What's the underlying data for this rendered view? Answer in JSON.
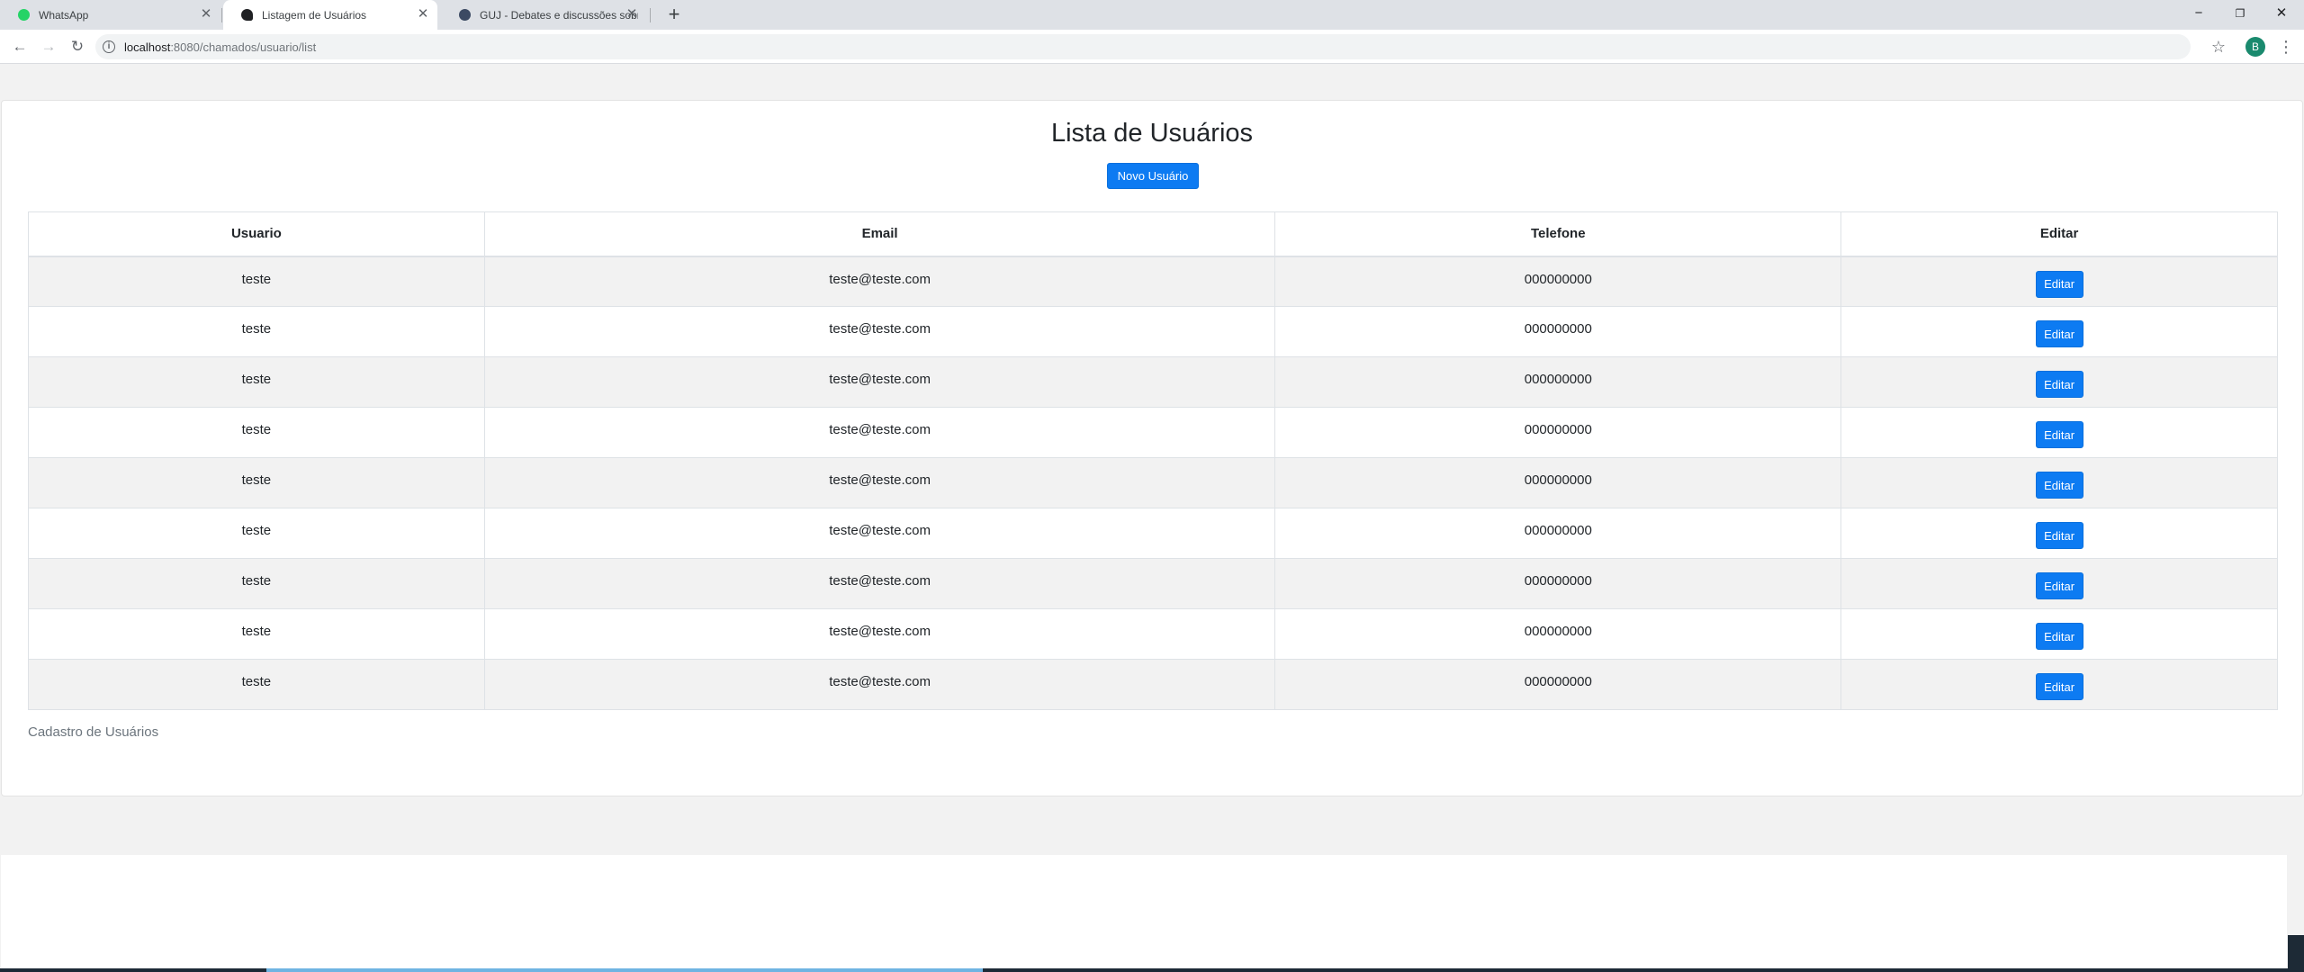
{
  "browser": {
    "tabs": [
      {
        "label": "WhatsApp",
        "favicon": "whatsapp-icon",
        "color": "#25d366",
        "active": false
      },
      {
        "label": "Listagem de Usuários",
        "favicon": "app-icon",
        "color": "#202124",
        "active": true
      },
      {
        "label": "GUJ - Debates e discussões sobre",
        "favicon": "guj-icon",
        "color": "#3c4a63",
        "active": false
      }
    ],
    "url_host": "localhost",
    "url_path": ":8080/chamados/usuario/list",
    "profile_initial": "B"
  },
  "page": {
    "title": "Lista de Usuários",
    "new_button": "Novo Usuário",
    "columns": [
      "Usuario",
      "Email",
      "Telefone",
      "Editar"
    ],
    "rows": [
      {
        "usuario": "teste",
        "email": "teste@teste.com",
        "telefone": "000000000",
        "action": "Editar"
      },
      {
        "usuario": "teste",
        "email": "teste@teste.com",
        "telefone": "000000000",
        "action": "Editar"
      },
      {
        "usuario": "teste",
        "email": "teste@teste.com",
        "telefone": "000000000",
        "action": "Editar"
      },
      {
        "usuario": "teste",
        "email": "teste@teste.com",
        "telefone": "000000000",
        "action": "Editar"
      },
      {
        "usuario": "teste",
        "email": "teste@teste.com",
        "telefone": "000000000",
        "action": "Editar"
      },
      {
        "usuario": "teste",
        "email": "teste@teste.com",
        "telefone": "000000000",
        "action": "Editar"
      },
      {
        "usuario": "teste",
        "email": "teste@teste.com",
        "telefone": "000000000",
        "action": "Editar"
      },
      {
        "usuario": "teste",
        "email": "teste@teste.com",
        "telefone": "000000000",
        "action": "Editar"
      },
      {
        "usuario": "teste",
        "email": "teste@teste.com",
        "telefone": "000000000",
        "action": "Editar"
      }
    ],
    "caption": "Cadastro de Usuários"
  },
  "colors": {
    "primary": "#0d7bf2",
    "stripe": "#f2f2f2"
  }
}
